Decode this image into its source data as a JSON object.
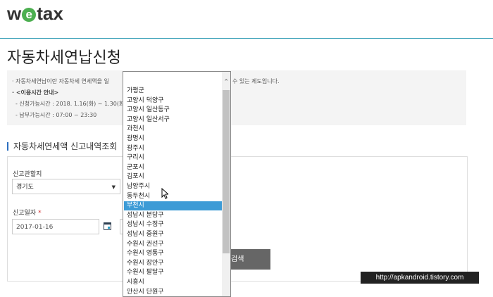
{
  "header": {
    "logo_pre": "w",
    "logo_e": "e",
    "logo_post": "tax"
  },
  "page": {
    "title": "자동차세연납신청"
  },
  "notice": {
    "line1": "· 자동차세연납이란 자동차세 연세액을 일",
    "line1_tail": "수 있는 제도입니다.",
    "line2": "· <이용시간 안내>",
    "line3": "- 신청가능시간 : 2018. 1.16(화) ~ 1.30(화",
    "line4": "- 납부가능시간 : 07:00 ~ 23:30"
  },
  "section": {
    "title": "자동차세연세액 신고내역조회"
  },
  "form": {
    "jurisdiction_label": "신고관할지",
    "jurisdiction_value": "경기도",
    "date_label": "신고일자",
    "required_mark": "*",
    "date_value": "2017-01-16",
    "search_label": "검색"
  },
  "dropdown": {
    "selected_index": 12,
    "items": [
      "가평군",
      "고양시 덕양구",
      "고양시 일산동구",
      "고양시 일산서구",
      "과천시",
      "광명시",
      "광주시",
      "구리시",
      "군포시",
      "김포시",
      "남양주시",
      "동두천시",
      "부천시",
      "성남시 분당구",
      "성남시 수정구",
      "성남시 중원구",
      "수원시 권선구",
      "수원시 영통구",
      "수원시 장안구",
      "수원시 팔달구",
      "시흥시",
      "안산시 단원구"
    ]
  },
  "watermark": {
    "text": "http://apkandroid.tistory.com"
  },
  "colors": {
    "accent": "#3aa0b8",
    "selected": "#3d9bd6",
    "button": "#666666",
    "logo_green": "#4caf50"
  }
}
